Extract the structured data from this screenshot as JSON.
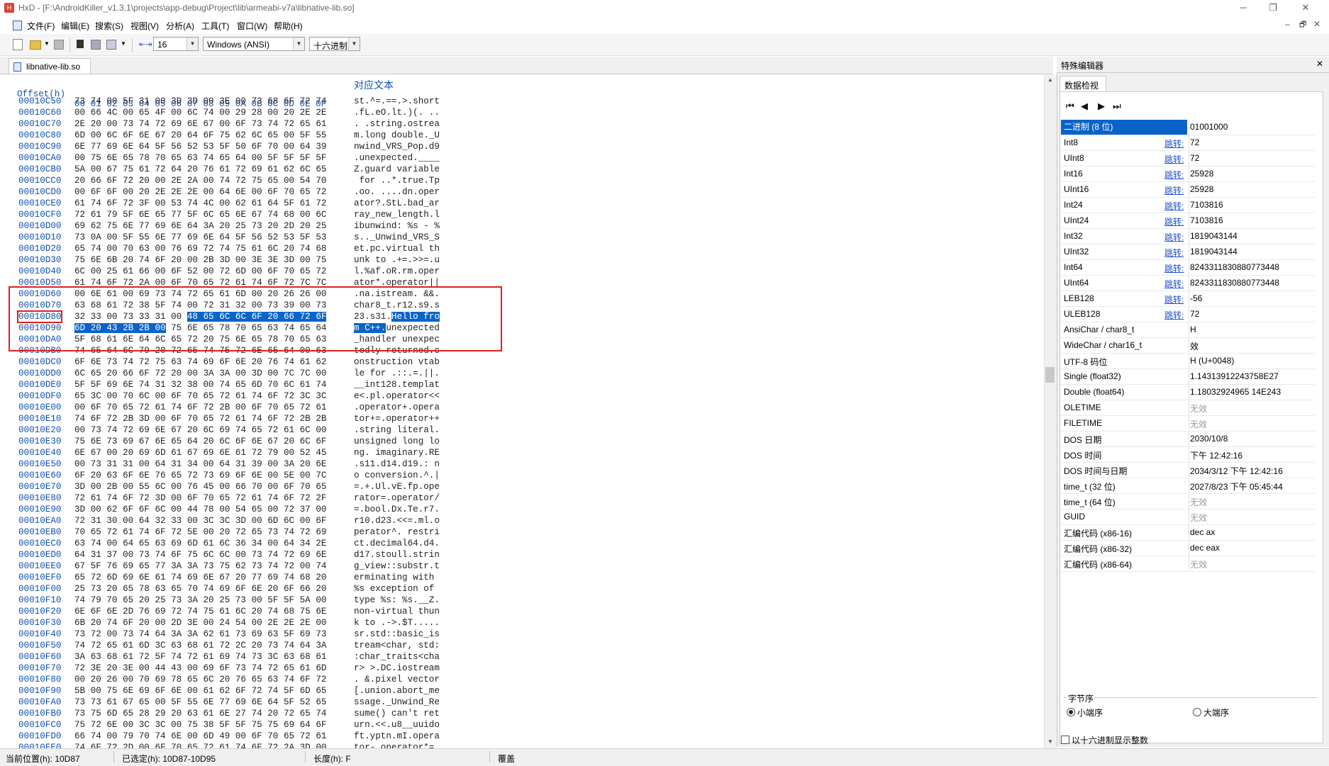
{
  "window": {
    "title": "HxD - [F:\\AndroidKiller_v1.3.1\\projects\\app-debug\\Project\\lib\\armeabi-v7a\\libnative-lib.so]",
    "minimize": "─",
    "maximize": "❐",
    "close": "✕",
    "inner_min": "–",
    "inner_restore": "🗗",
    "inner_close": "✕"
  },
  "menu": [
    "文件(F)",
    "编辑(E)",
    "搜索(S)",
    "视图(V)",
    "分析(A)",
    "工具(T)",
    "窗口(W)",
    "帮助(H)"
  ],
  "toolbar": {
    "bytes_per_row": "16",
    "charset": "Windows (ANSI)",
    "offset_base": "十六进制"
  },
  "editor": {
    "tab_label": "libnative-lib.so",
    "header_offset": "Offset(h)",
    "header_bytes": "00 01 02 03 04 05 06 07 08 09 0A 0B 0C 0D 0E 0F",
    "header_text": "对应文本",
    "rows": [
      {
        "o": "00010C50",
        "h": "73 74 00 5F 31 00 3D 3D 00 3E 00 73 68 6F 72 74",
        "t": "st.^=.==.>.short"
      },
      {
        "o": "00010C60",
        "h": "00 66 4C 00 65 4F 00 6C 74 00 29 28 00 20 2E 2E",
        "t": ".fL.eO.lt.)(. .."
      },
      {
        "o": "00010C70",
        "h": "2E 20 00 73 74 72 69 6E 67 00 6F 73 74 72 65 61",
        "t": ". .string.ostrea"
      },
      {
        "o": "00010C80",
        "h": "6D 00 6C 6F 6E 67 20 64 6F 75 62 6C 65 00 5F 55",
        "t": "m.long double._U"
      },
      {
        "o": "00010C90",
        "h": "6E 77 69 6E 64 5F 56 52 53 5F 50 6F 70 00 64 39",
        "t": "nwind_VRS_Pop.d9"
      },
      {
        "o": "00010CA0",
        "h": "00 75 6E 65 78 70 65 63 74 65 64 00 5F 5F 5F 5F",
        "t": ".unexpected.____"
      },
      {
        "o": "00010CB0",
        "h": "5A 00 67 75 61 72 64 20 76 61 72 69 61 62 6C 65",
        "t": "Z.guard variable"
      },
      {
        "o": "00010CC0",
        "h": "20 66 6F 72 20 00 2E 2A 00 74 72 75 65 00 54 70",
        "t": " for ..*.true.Tp"
      },
      {
        "o": "00010CD0",
        "h": "00 6F 6F 00 20 2E 2E 2E 00 64 6E 00 6F 70 65 72",
        "t": ".oo. ....dn.oper"
      },
      {
        "o": "00010CE0",
        "h": "61 74 6F 72 3F 00 53 74 4C 00 62 61 64 5F 61 72",
        "t": "ator?.StL.bad_ar"
      },
      {
        "o": "00010CF0",
        "h": "72 61 79 5F 6E 65 77 5F 6C 65 6E 67 74 68 00 6C",
        "t": "ray_new_length.l"
      },
      {
        "o": "00010D00",
        "h": "69 62 75 6E 77 69 6E 64 3A 20 25 73 20 2D 20 25",
        "t": "ibunwind: %s - %"
      },
      {
        "o": "00010D10",
        "h": "73 0A 00 5F 55 6E 77 69 6E 64 5F 56 52 53 5F 53",
        "t": "s.._Unwind_VRS_S"
      },
      {
        "o": "00010D20",
        "h": "65 74 00 70 63 00 76 69 72 74 75 61 6C 20 74 68",
        "t": "et.pc.virtual th"
      },
      {
        "o": "00010D30",
        "h": "75 6E 6B 20 74 6F 20 00 2B 3D 00 3E 3E 3D 00 75",
        "t": "unk to .+=.>>=.u"
      },
      {
        "o": "00010D40",
        "h": "6C 00 25 61 66 00 6F 52 00 72 6D 00 6F 70 65 72",
        "t": "l.%af.oR.rm.oper"
      },
      {
        "o": "00010D50",
        "h": "61 74 6F 72 2A 00 6F 70 65 72 61 74 6F 72 7C 7C",
        "t": "ator*.operator||"
      },
      {
        "o": "00010D60",
        "h": "00 6E 61 00 69 73 74 72 65 61 6D 00 20 26 26 00",
        "t": ".na.istream. &&."
      },
      {
        "o": "00010D70",
        "h": "63 68 61 72 38 5F 74 00 72 31 32 00 73 39 00 73",
        "t": "char8_t.r12.s9.s"
      },
      {
        "o": "00010D80",
        "h": "32 33 00 73 33 31 00 48 65 6C 6C 6F 20 66 72 6F",
        "t": "23.s31.Hello fro"
      },
      {
        "o": "00010D90",
        "h": "6D 20 43 2B 2B 00 75 6E 65 78 70 65 63 74 65 64",
        "t": "m C++.unexpected"
      },
      {
        "o": "00010DA0",
        "h": "5F 68 61 6E 64 6C 65 72 20 75 6E 65 78 70 65 63",
        "t": "_handler unexpec"
      },
      {
        "o": "00010DB0",
        "h": "74 65 64 6C 79 20 72 65 74 75 72 6E 65 64 00 63",
        "t": "tedly returned.c"
      },
      {
        "o": "00010DC0",
        "h": "6F 6E 73 74 72 75 63 74 69 6F 6E 20 76 74 61 62",
        "t": "onstruction vtab"
      },
      {
        "o": "00010DD0",
        "h": "6C 65 20 66 6F 72 20 00 3A 3A 00 3D 00 7C 7C 00",
        "t": "le for .::.=.||."
      },
      {
        "o": "00010DE0",
        "h": "5F 5F 69 6E 74 31 32 38 00 74 65 6D 70 6C 61 74",
        "t": "__int128.templat"
      },
      {
        "o": "00010DF0",
        "h": "65 3C 00 70 6C 00 6F 70 65 72 61 74 6F 72 3C 3C",
        "t": "e<.pl.operator<<"
      },
      {
        "o": "00010E00",
        "h": "00 6F 70 65 72 61 74 6F 72 2B 00 6F 70 65 72 61",
        "t": ".operator+.opera"
      },
      {
        "o": "00010E10",
        "h": "74 6F 72 2B 3D 00 6F 70 65 72 61 74 6F 72 2B 2B",
        "t": "tor+=.operator++"
      },
      {
        "o": "00010E20",
        "h": "00 73 74 72 69 6E 67 20 6C 69 74 65 72 61 6C 00",
        "t": ".string literal."
      },
      {
        "o": "00010E30",
        "h": "75 6E 73 69 67 6E 65 64 20 6C 6F 6E 67 20 6C 6F",
        "t": "unsigned long lo"
      },
      {
        "o": "00010E40",
        "h": "6E 67 00 20 69 6D 61 67 69 6E 61 72 79 00 52 45",
        "t": "ng. imaginary.RE"
      },
      {
        "o": "00010E50",
        "h": "00 73 31 31 00 64 31 34 00 64 31 39 00 3A 20 6E",
        "t": ".s11.d14.d19.: n"
      },
      {
        "o": "00010E60",
        "h": "6F 20 63 6F 6E 76 65 72 73 69 6F 6E 00 5E 00 7C",
        "t": "o conversion.^.|"
      },
      {
        "o": "00010E70",
        "h": "3D 00 2B 00 55 6C 00 76 45 00 66 70 00 6F 70 65",
        "t": "=.+.Ul.vE.fp.ope"
      },
      {
        "o": "00010E80",
        "h": "72 61 74 6F 72 3D 00 6F 70 65 72 61 74 6F 72 2F",
        "t": "rator=.operator/"
      },
      {
        "o": "00010E90",
        "h": "3D 00 62 6F 6F 6C 00 44 78 00 54 65 00 72 37 00",
        "t": "=.bool.Dx.Te.r7."
      },
      {
        "o": "00010EA0",
        "h": "72 31 30 00 64 32 33 00 3C 3C 3D 00 6D 6C 00 6F",
        "t": "r10.d23.<<=.ml.o"
      },
      {
        "o": "00010EB0",
        "h": "70 65 72 61 74 6F 72 5E 00 20 72 65 73 74 72 69",
        "t": "perator^. restri"
      },
      {
        "o": "00010EC0",
        "h": "63 74 00 64 65 63 69 6D 61 6C 36 34 00 64 34 2E",
        "t": "ct.decimal64.d4."
      },
      {
        "o": "00010ED0",
        "h": "64 31 37 00 73 74 6F 75 6C 6C 00 73 74 72 69 6E",
        "t": "d17.stoull.strin"
      },
      {
        "o": "00010EE0",
        "h": "67 5F 76 69 65 77 3A 3A 73 75 62 73 74 72 00 74",
        "t": "g_view::substr.t"
      },
      {
        "o": "00010EF0",
        "h": "65 72 6D 69 6E 61 74 69 6E 67 20 77 69 74 68 20",
        "t": "erminating with "
      },
      {
        "o": "00010F00",
        "h": "25 73 20 65 78 63 65 70 74 69 6F 6E 20 6F 66 20",
        "t": "%s exception of "
      },
      {
        "o": "00010F10",
        "h": "74 79 70 65 20 25 73 3A 20 25 73 00 5F 5F 5A 00",
        "t": "type %s: %s.__Z."
      },
      {
        "o": "00010F20",
        "h": "6E 6F 6E 2D 76 69 72 74 75 61 6C 20 74 68 75 6E",
        "t": "non-virtual thun"
      },
      {
        "o": "00010F30",
        "h": "6B 20 74 6F 20 00 2D 3E 00 24 54 00 2E 2E 2E 00",
        "t": "k to .->.$T....."
      },
      {
        "o": "00010F40",
        "h": "73 72 00 73 74 64 3A 3A 62 61 73 69 63 5F 69 73",
        "t": "sr.std::basic_is"
      },
      {
        "o": "00010F50",
        "h": "74 72 65 61 6D 3C 63 68 61 72 2C 20 73 74 64 3A",
        "t": "tream<char, std:"
      },
      {
        "o": "00010F60",
        "h": "3A 63 68 61 72 5F 74 72 61 69 74 73 3C 63 68 61",
        "t": ":char_traits<cha"
      },
      {
        "o": "00010F70",
        "h": "72 3E 20 3E 00 44 43 00 69 6F 73 74 72 65 61 6D",
        "t": "r> >.DC.iostream"
      },
      {
        "o": "00010F80",
        "h": "00 20 26 00 70 69 78 65 6C 20 76 65 63 74 6F 72",
        "t": ". &.pixel vector"
      },
      {
        "o": "00010F90",
        "h": "5B 00 75 6E 69 6F 6E 00 61 62 6F 72 74 5F 6D 65",
        "t": "[.union.abort_me"
      },
      {
        "o": "00010FA0",
        "h": "73 73 61 67 65 00 5F 55 6E 77 69 6E 64 5F 52 65",
        "t": "ssage._Unwind_Re"
      },
      {
        "o": "00010FB0",
        "h": "73 75 6D 65 28 29 20 63 61 6E 27 74 20 72 65 74",
        "t": "sume() can't ret"
      },
      {
        "o": "00010FC0",
        "h": "75 72 6E 00 3C 3C 00 75 38 5F 5F 75 75 69 64 6F",
        "t": "urn.<<.u8__uuido"
      },
      {
        "o": "00010FD0",
        "h": "66 74 00 79 70 74 6E 00 6D 49 00 6F 70 65 72 61",
        "t": "ft.yptn.mI.opera"
      },
      {
        "o": "00010FE0",
        "h": "74 6F 72 2D 00 6F 70 65 72 61 74 6F 72 2A 3D 00",
        "t": "tor-.operator*=."
      }
    ]
  },
  "special_editor": {
    "title": "特殊编辑器",
    "close": "✕",
    "tab": "数据检视",
    "nav": [
      "⏮",
      "◀",
      "▶",
      "⏭"
    ],
    "jump": "跳转:",
    "rows": [
      {
        "name": "二进制 (8 位)",
        "value": "01001000",
        "jump": false,
        "gray": false,
        "hl": true
      },
      {
        "name": "Int8",
        "value": "72",
        "jump": true,
        "gray": false,
        "hl": false
      },
      {
        "name": "UInt8",
        "value": "72",
        "jump": true,
        "gray": false,
        "hl": false
      },
      {
        "name": "Int16",
        "value": "25928",
        "jump": true,
        "gray": false,
        "hl": false
      },
      {
        "name": "UInt16",
        "value": "25928",
        "jump": true,
        "gray": false,
        "hl": false
      },
      {
        "name": "Int24",
        "value": "7103816",
        "jump": true,
        "gray": false,
        "hl": false
      },
      {
        "name": "UInt24",
        "value": "7103816",
        "jump": true,
        "gray": false,
        "hl": false
      },
      {
        "name": "Int32",
        "value": "1819043144",
        "jump": true,
        "gray": false,
        "hl": false
      },
      {
        "name": "UInt32",
        "value": "1819043144",
        "jump": true,
        "gray": false,
        "hl": false
      },
      {
        "name": "Int64",
        "value": "8243311830880773448",
        "jump": true,
        "gray": false,
        "hl": false
      },
      {
        "name": "UInt64",
        "value": "8243311830880773448",
        "jump": true,
        "gray": false,
        "hl": false
      },
      {
        "name": "LEB128",
        "value": "-56",
        "jump": true,
        "gray": false,
        "hl": false
      },
      {
        "name": "ULEB128",
        "value": "72",
        "jump": true,
        "gray": false,
        "hl": false
      },
      {
        "name": "AnsiChar / char8_t",
        "value": "H",
        "jump": false,
        "gray": false,
        "hl": false
      },
      {
        "name": "WideChar / char16_t",
        "value": "效",
        "jump": false,
        "gray": false,
        "hl": false
      },
      {
        "name": "UTF-8 码位",
        "value": "H (U+0048)",
        "jump": false,
        "gray": false,
        "hl": false
      },
      {
        "name": "Single (float32)",
        "value": "1.14313912243758E27",
        "jump": false,
        "gray": false,
        "hl": false
      },
      {
        "name": "Double (float64)",
        "value": "1.18032924965 14E243",
        "jump": false,
        "gray": false,
        "hl": false
      },
      {
        "name": "OLETIME",
        "value": "无效",
        "jump": false,
        "gray": true,
        "hl": false
      },
      {
        "name": "FILETIME",
        "value": "无效",
        "jump": false,
        "gray": true,
        "hl": false
      },
      {
        "name": "DOS 日期",
        "value": "2030/10/8",
        "jump": false,
        "gray": false,
        "hl": false
      },
      {
        "name": "DOS 时间",
        "value": "下午 12:42:16",
        "jump": false,
        "gray": false,
        "hl": false
      },
      {
        "name": "DOS 时间与日期",
        "value": "2034/3/12 下午 12:42:16",
        "jump": false,
        "gray": false,
        "hl": false
      },
      {
        "name": "time_t (32 位)",
        "value": "2027/8/23 下午 05:45:44",
        "jump": false,
        "gray": false,
        "hl": false
      },
      {
        "name": "time_t (64 位)",
        "value": "无效",
        "jump": false,
        "gray": true,
        "hl": false
      },
      {
        "name": "GUID",
        "value": "无效",
        "jump": false,
        "gray": true,
        "hl": false
      },
      {
        "name": "汇编代码 (x86-16)",
        "value": "dec ax",
        "jump": false,
        "gray": false,
        "hl": false
      },
      {
        "name": "汇编代码 (x86-32)",
        "value": "dec eax",
        "jump": false,
        "gray": false,
        "hl": false
      },
      {
        "name": "汇编代码 (x86-64)",
        "value": "无效",
        "jump": false,
        "gray": true,
        "hl": false
      }
    ],
    "byte_order_label": "字节序",
    "little_endian": "小端序",
    "big_endian": "大端序",
    "hex_ints_label": "以十六进制显示整数"
  },
  "status": {
    "position": "当前位置(h): 10D87",
    "selection": "已选定(h): 10D87-10D95",
    "length": "长度(h): F",
    "mode": "覆盖"
  },
  "colors": {
    "selection": "#0a64c8",
    "offset_blue": "#1050b0",
    "annotation_red": "#e02020"
  }
}
